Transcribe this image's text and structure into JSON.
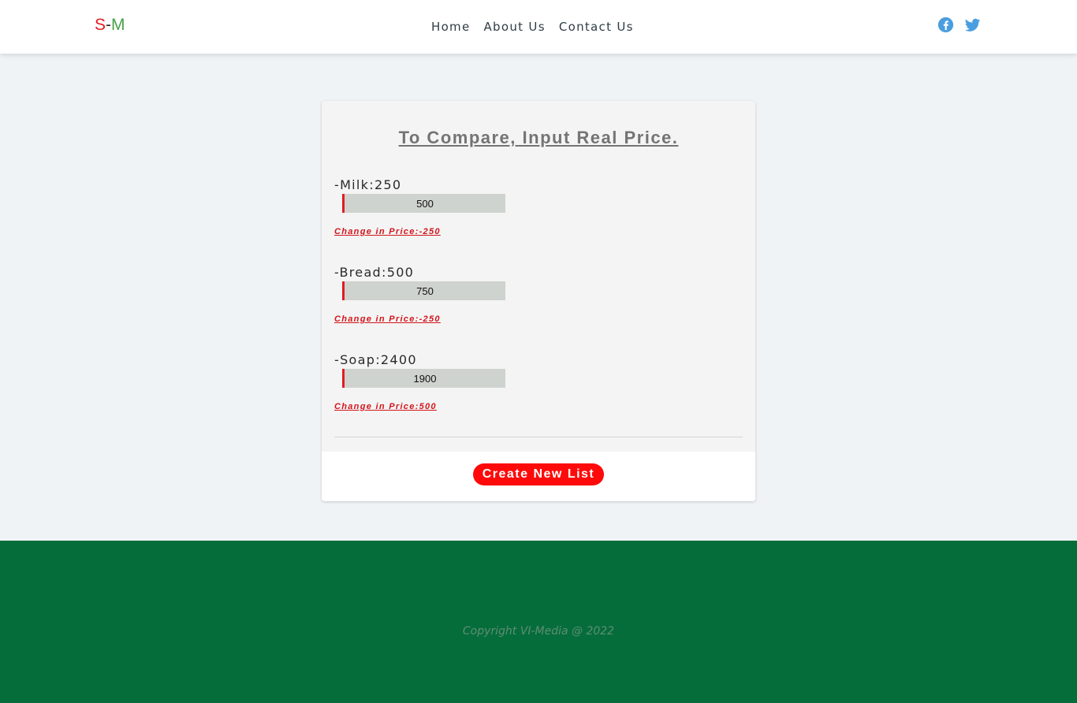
{
  "brand": {
    "s": "S",
    "dash": "-",
    "m": "M"
  },
  "nav": {
    "items": [
      "Home",
      "About Us",
      "Contact Us"
    ]
  },
  "social": {
    "icons": [
      "facebook-icon",
      "twitter-icon"
    ],
    "color": "#4a9ee0"
  },
  "card": {
    "title": "To Compare, Input Real Price.",
    "items": [
      {
        "name": "-Milk",
        "colon": ":",
        "price": "250",
        "input_value": "500",
        "change": "Change in Price:-250"
      },
      {
        "name": "-Bread",
        "colon": ":",
        "price": "500",
        "input_value": "750",
        "change": "Change in Price:-250"
      },
      {
        "name": "-Soap",
        "colon": ":",
        "price": "2400",
        "input_value": "1900",
        "change": "Change in Price:500"
      }
    ],
    "button_label": "Create New List"
  },
  "footer": {
    "copyright": "Copyright VI-Media @ 2022"
  },
  "colors": {
    "accent_red": "#ff0a0a",
    "footer_green": "#056d3a",
    "page_bg": "#eff3f6"
  }
}
